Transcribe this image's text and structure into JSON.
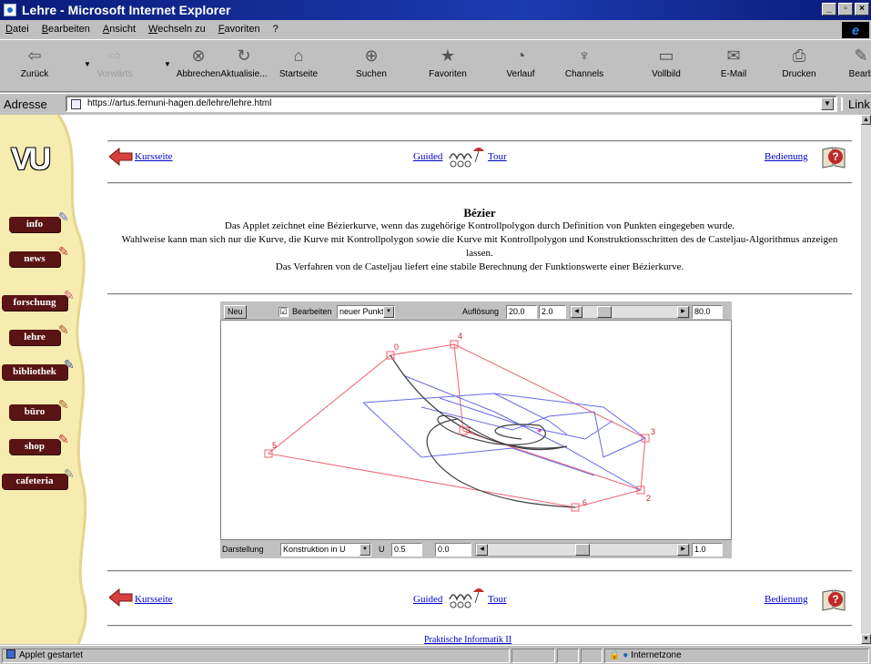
{
  "window": {
    "title": "Lehre - Microsoft Internet Explorer"
  },
  "menu": [
    "Datei",
    "Bearbeiten",
    "Ansicht",
    "Wechseln zu",
    "Favoriten",
    "?"
  ],
  "toolbar": [
    {
      "label": "Zurück",
      "icon": "back-arrow-icon",
      "glyph": "⇦",
      "disabled": false
    },
    {
      "label": "Vorwärts",
      "icon": "forward-arrow-icon",
      "glyph": "⇨",
      "disabled": true
    },
    {
      "label": "Abbrechen",
      "icon": "stop-icon",
      "glyph": "⊗",
      "disabled": false
    },
    {
      "label": "Aktualisie...",
      "icon": "refresh-icon",
      "glyph": "↻",
      "disabled": false
    },
    {
      "label": "Startseite",
      "icon": "home-icon",
      "glyph": "⌂",
      "disabled": false
    },
    {
      "label": "Suchen",
      "icon": "search-icon",
      "glyph": "⊕",
      "disabled": false
    },
    {
      "label": "Favoriten",
      "icon": "favorites-icon",
      "glyph": "★",
      "disabled": false
    },
    {
      "label": "Verlauf",
      "icon": "history-icon",
      "glyph": "◔",
      "disabled": false
    },
    {
      "label": "Channels",
      "icon": "channels-icon",
      "glyph": "♆",
      "disabled": false
    },
    {
      "label": "Vollbild",
      "icon": "fullscreen-icon",
      "glyph": "▭",
      "disabled": false
    },
    {
      "label": "E-Mail",
      "icon": "mail-icon",
      "glyph": "✉",
      "disabled": false
    },
    {
      "label": "Drucken",
      "icon": "print-icon",
      "glyph": "⎙",
      "disabled": false
    },
    {
      "label": "Bearb",
      "icon": "edit-icon",
      "glyph": "✎",
      "disabled": false
    }
  ],
  "address": {
    "label": "Adresse",
    "url": "https://artus.fernuni-hagen.de/lehre/lehre.html",
    "links_label": "Link"
  },
  "sidebar": {
    "logo": "VU",
    "items": [
      "info",
      "news",
      "forschung",
      "lehre",
      "bibliothek",
      "büro",
      "shop",
      "cafeteria"
    ]
  },
  "nav": {
    "back": "Kursseite",
    "tour_left": "Guided",
    "tour_right": "Tour",
    "help": "Bedienung"
  },
  "article": {
    "title": "Bézier",
    "p1": "Das Applet zeichnet eine Bézierkurve, wenn das zugehörige Kontrollpolygon durch Definition von Punkten eingegeben wurde.",
    "p2": "Wahlweise kann man sich nur die Kurve, die Kurve mit Kontrollpolygon sowie die Kurve mit Kontrollpolygon und Konstruktionsschritten des de Casteljau-Algorithmus anzeigen lassen.",
    "p3": "Das Verfahren von de Casteljau liefert eine stabile Berechnung der Funktionswerte einer Bézierkurve."
  },
  "applet": {
    "new_button": "Neu",
    "edit_checked": "☑",
    "edit_label": "Bearbeiten",
    "mode_select": "neuer Punkt",
    "resolution_label": "Auflösung",
    "resolution_a": "20.0",
    "resolution_b": "2.0",
    "resolution_max": "80.0",
    "resolution_level": 0.18,
    "display_label": "Darstellung",
    "display_select": "Konstruktion in U",
    "u_label": "U",
    "u_value": "0.5",
    "u_field": "0.0",
    "u_max": "1.0",
    "u_level": 0.5,
    "colors": {
      "polygon": "#f06070",
      "construction": "#6a6ae8",
      "curve": "#404040",
      "point_label": "#cc2030"
    },
    "control_points": [
      {
        "label": "0"
      },
      {
        "label": "4"
      },
      {
        "label": "3"
      },
      {
        "label": "2"
      },
      {
        "label": "6"
      },
      {
        "label": "5"
      },
      {
        "label": "1"
      }
    ]
  },
  "footer_link": "Praktische Informatik II",
  "status": {
    "text": "Applet gestartet",
    "zone": "Internetzone"
  }
}
